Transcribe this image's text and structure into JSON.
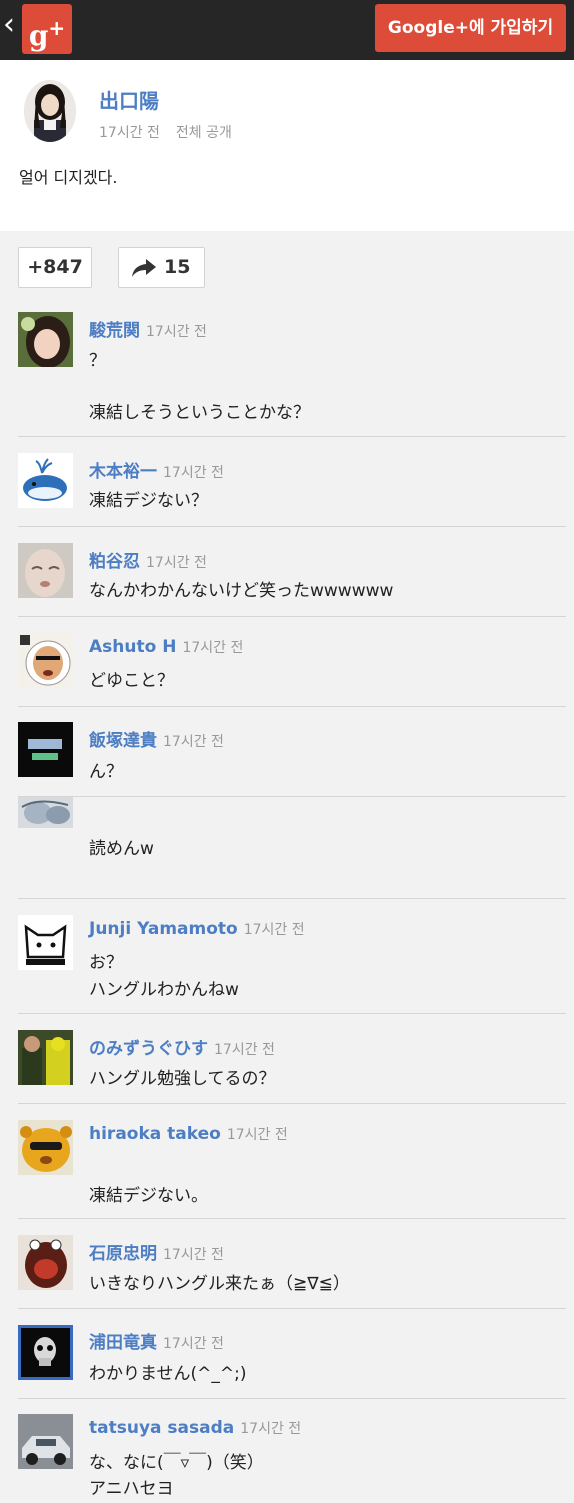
{
  "topbar": {
    "logo_text": "g",
    "logo_plus": "+",
    "join_label": "Google+에 가입하기",
    "back_glyph": "‹",
    "brand_color": "#dd4b39"
  },
  "post": {
    "author": "出口陽",
    "time": "17시간 전",
    "visibility": "전체 공개",
    "text": "얼어 디지겠다."
  },
  "actions": {
    "plus_count": "+847",
    "share_count": "15"
  },
  "comments": [
    {
      "name": "駿荒関",
      "time": "17시간 전",
      "lines": [
        "？",
        "",
        "凍結しそうということかな？"
      ]
    },
    {
      "name": "木本裕一",
      "time": "17시간 전",
      "lines": [
        "凍結デジない？"
      ]
    },
    {
      "name": "粕谷忍",
      "time": "17시간 전",
      "lines": [
        "なんかわかんないけど笑ったwwwwww"
      ]
    },
    {
      "name": "Ashuto H",
      "time": "17시간 전",
      "lines": [
        "どゆこと？"
      ]
    },
    {
      "name": "飯塚達貴",
      "time": "17시간 전",
      "lines": [
        "ん？"
      ]
    },
    {
      "name": "",
      "time": "",
      "lines": [
        "",
        "読めんw"
      ]
    },
    {
      "name": "Junji Yamamoto",
      "time": "17시간 전",
      "lines": [
        "お？",
        "ハングルわかんねw"
      ]
    },
    {
      "name": "のみずうぐひす",
      "time": "17시간 전",
      "lines": [
        "ハングル勉強してるの？"
      ]
    },
    {
      "name": "hiraoka takeo",
      "time": "17시간 전",
      "lines": [
        "",
        "凍結デジない。"
      ]
    },
    {
      "name": "石原忠明",
      "time": "17시간 전",
      "lines": [
        "いきなりハングル来たぁ（≧∇≦）"
      ]
    },
    {
      "name": "浦田竜真",
      "time": "17시간 전",
      "lines": [
        "わかりません(^_^;)"
      ]
    },
    {
      "name": "tatsuya sasada",
      "time": "17시간 전",
      "lines": [
        "な、なに(￣▿￣)（笑）",
        "アニハセヨ"
      ]
    }
  ]
}
